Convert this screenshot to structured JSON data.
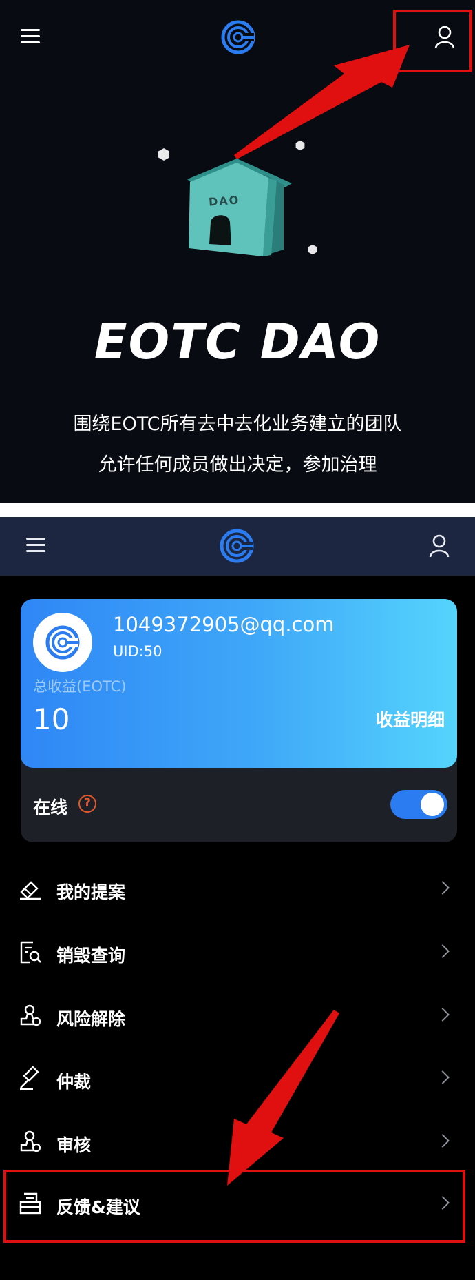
{
  "top_screen": {
    "house_label": "DAO",
    "title": "EOTC DAO",
    "subtitle_line1": "围绕EOTC所有去中去化业务建立的团队",
    "subtitle_line2": "允许任何成员做出决定，参加治理"
  },
  "profile": {
    "email": "1049372905@qq.com",
    "uid": "UID:50",
    "earnings_label": "总收益(EOTC)",
    "earnings_value": "10",
    "earnings_detail_link": "收益明细",
    "online_label": "在线",
    "help_glyph": "?",
    "online_toggle": true
  },
  "menu": [
    {
      "label": "我的提案",
      "icon": "proposal-icon"
    },
    {
      "label": "销毁查询",
      "icon": "burn-query-icon"
    },
    {
      "label": "风险解除",
      "icon": "risk-release-icon"
    },
    {
      "label": "仲裁",
      "icon": "arbitration-icon"
    },
    {
      "label": "审核",
      "icon": "review-icon"
    },
    {
      "label": "反馈&建议",
      "icon": "feedback-icon"
    }
  ],
  "colors": {
    "accent_blue": "#2f87f6",
    "card_gradient_end": "#55d4fc",
    "annotation_red": "#e01010",
    "help_orange": "#e0572a",
    "navbar": "#1c2640"
  }
}
